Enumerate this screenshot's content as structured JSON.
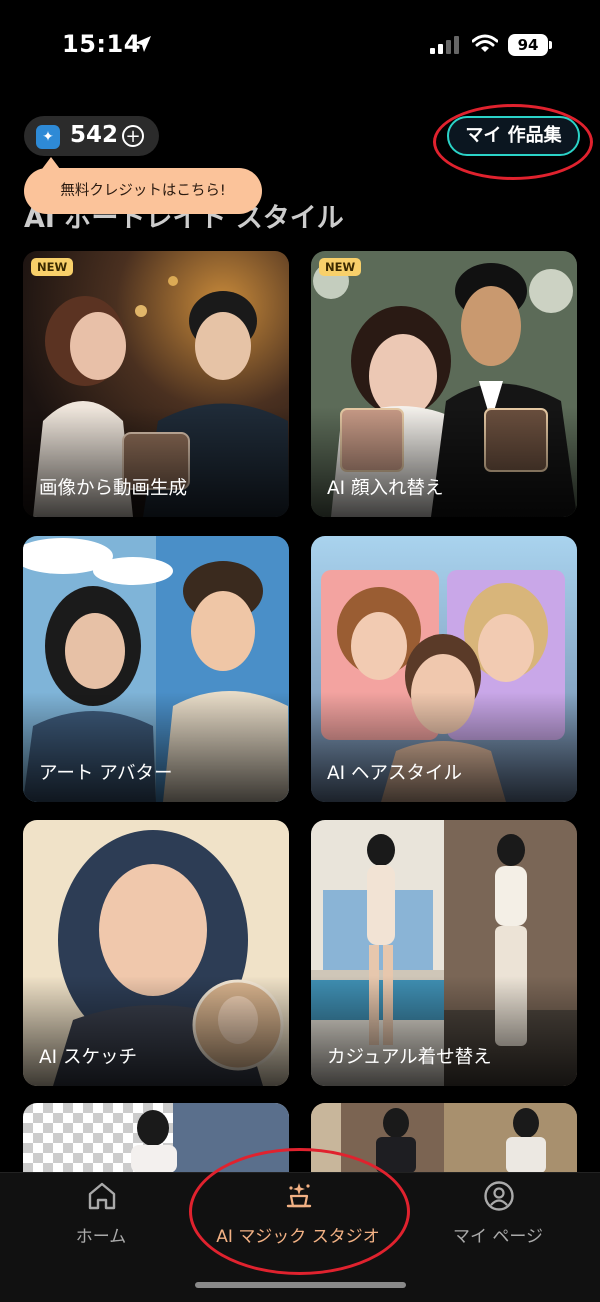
{
  "status_bar": {
    "time": "15:14",
    "battery": "94"
  },
  "header": {
    "credits": "542",
    "my_works_button": "マイ 作品集",
    "tooltip": "無料クレジットはこちら!"
  },
  "section_title": "AI ポートレイト スタイル",
  "cards": [
    {
      "label": "画像から動画生成",
      "badge": "NEW"
    },
    {
      "label": "AI 顔入れ替え",
      "badge": "NEW"
    },
    {
      "label": "アート アバター"
    },
    {
      "label": "AI ヘアスタイル"
    },
    {
      "label": "AI スケッチ"
    },
    {
      "label": "カジュアル着せ替え"
    }
  ],
  "bottom_nav": [
    {
      "label": "ホーム",
      "icon": "home-icon"
    },
    {
      "label": "AI マジック スタジオ",
      "icon": "magic-hat-icon",
      "active": true
    },
    {
      "label": "マイ ページ",
      "icon": "profile-icon"
    }
  ],
  "colors": {
    "accent": "#f2b184",
    "outline": "#2bd3c7",
    "annotation": "#e0222e"
  }
}
